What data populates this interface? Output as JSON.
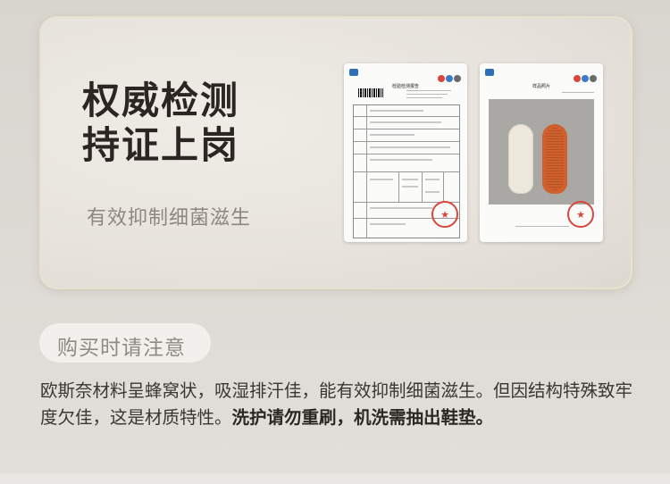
{
  "hero": {
    "title_line1": "权威检测",
    "title_line2": "持证上岗",
    "subtitle": "有效抑制细菌滋生"
  },
  "documents": {
    "report1": {
      "heading": "检验检测报告",
      "stamp": "★"
    },
    "report2": {
      "heading": "样品照片",
      "stamp": "★"
    }
  },
  "notice": {
    "heading": "购买时请注意",
    "text_part1": "欧斯奈材料呈蜂窝状，吸湿排汗佳，能有效抑制细菌滋生。但因结构特殊致牢度欠佳，这是材质特性。",
    "text_bold": "洗护请勿重刷，机洗需抽出鞋垫。"
  },
  "colors": {
    "title": "#2b2622",
    "subtitle": "#8c8780",
    "insole_orange": "#d1612c",
    "stamp_red": "#d9463a"
  }
}
